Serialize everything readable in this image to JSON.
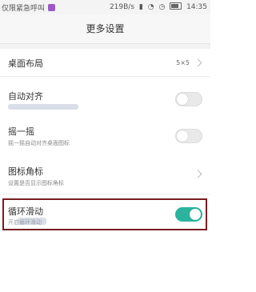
{
  "status_bar": {
    "left_text": "仅限紧急呼叫",
    "speed": "219B/s",
    "time": "14:35",
    "icons": [
      "signal-icon",
      "wifi-icon",
      "alarm-icon",
      "battery-icon"
    ]
  },
  "header": {
    "title": "更多设置"
  },
  "settings": {
    "desktop_layout": {
      "title": "桌面布局",
      "value": "5×5"
    },
    "auto_align": {
      "title": "自动对齐",
      "enabled": false
    },
    "shake": {
      "title": "摇一摇",
      "subtitle": "摇一摇自动对齐桌面图标",
      "enabled": false
    },
    "icon_badge": {
      "title": "图标角标",
      "subtitle": "设置是否显示图标角标"
    },
    "loop_scroll": {
      "title": "循环滑动",
      "subtitle": "开启循环滑动",
      "enabled": true
    }
  },
  "colors": {
    "accent": "#2bb39e",
    "highlight_border": "#7a1d24"
  }
}
